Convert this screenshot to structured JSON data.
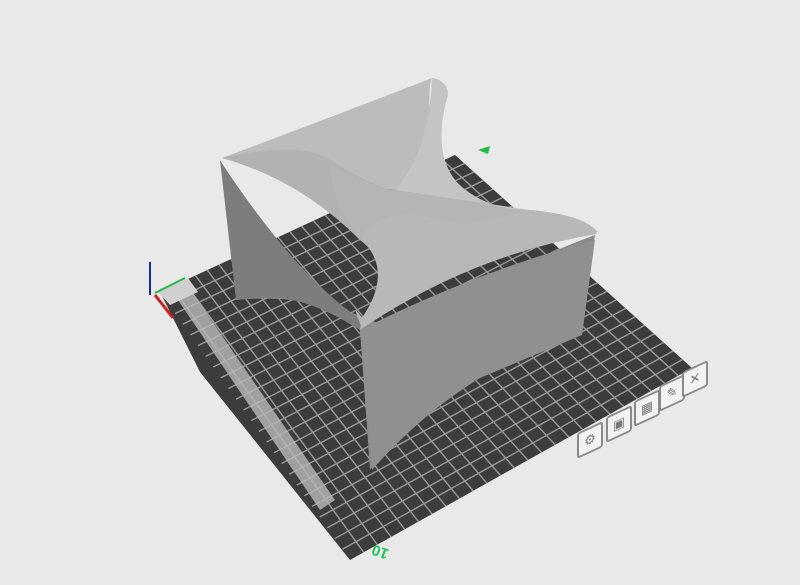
{
  "viewport": {
    "bed_label": "10",
    "bed_color": "#3c3c3c",
    "grid_color": "#9a9a9a",
    "model_color": "#a9a9a9",
    "background": "#e9e9e9"
  },
  "toolbar": [
    {
      "icon": "settings-icon",
      "glyph": "⚙"
    },
    {
      "icon": "lock-icon",
      "glyph": "▣"
    },
    {
      "icon": "calculator-icon",
      "glyph": "▦"
    },
    {
      "icon": "edit-icon",
      "glyph": "✎"
    },
    {
      "icon": "close-icon",
      "glyph": "✕"
    }
  ]
}
